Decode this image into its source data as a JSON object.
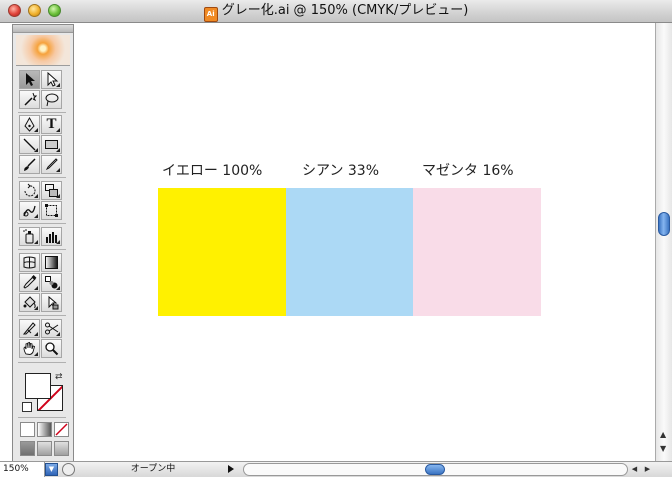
{
  "window": {
    "title": "グレー化.ai @ 150% (CMYK/プレビュー)",
    "file_icon_text": "Ai"
  },
  "artboard": {
    "swatches": [
      {
        "label": "イエロー 100%",
        "color": "#FFF100"
      },
      {
        "label": "シアン 33%",
        "color": "#ACD9F5"
      },
      {
        "label": "マゼンタ 16%",
        "color": "#F9DCE8"
      }
    ]
  },
  "palette": {
    "tools": [
      "selection-tool",
      "direct-selection-tool",
      "magic-wand-tool",
      "lasso-tool",
      "pen-tool",
      "type-tool",
      "line-tool",
      "rectangle-tool",
      "paintbrush-tool",
      "pencil-tool",
      "rotate-tool",
      "scale-tool",
      "warp-tool",
      "free-transform-tool",
      "symbol-sprayer-tool",
      "graph-tool",
      "mesh-tool",
      "gradient-tool",
      "eyedropper-tool",
      "blend-tool",
      "live-paint-bucket-tool",
      "live-paint-selection-tool",
      "slice-tool",
      "scissors-tool",
      "hand-tool",
      "zoom-tool"
    ],
    "type_tool_glyph": "T"
  },
  "statusbar": {
    "zoom": "150%",
    "status_text": "オープン中"
  },
  "colors": {
    "scroll_blue": "#3B74C2",
    "stroke_none_red": "#D0021B"
  }
}
